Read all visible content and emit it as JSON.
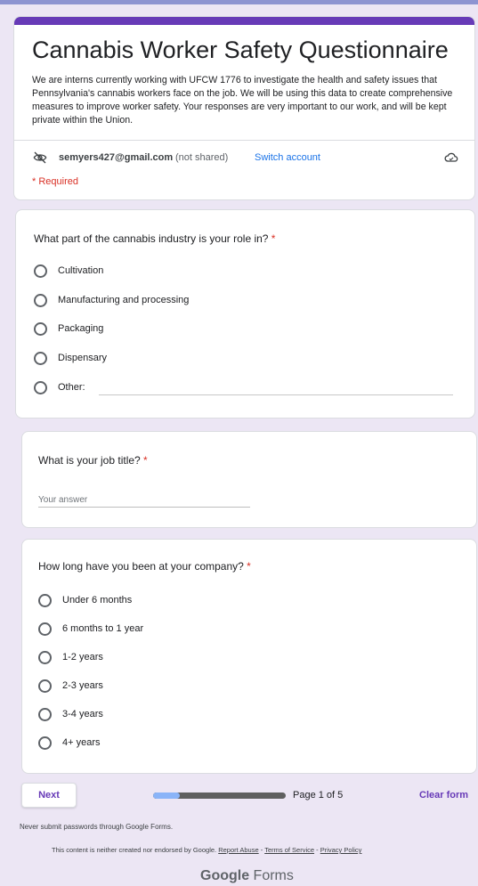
{
  "form": {
    "title": "Cannabis Worker Safety Questionnaire",
    "description": "We are interns currently working with UFCW 1776 to investigate the health and safety issues that Pennsylvania's cannabis workers face on the job. We will be using this data to create comprehensive measures to improve worker safety. Your responses are very important to our work, and will be kept private within the Union.",
    "account_email": "semyers427@gmail.com",
    "not_shared": "(not shared)",
    "switch_account": "Switch account",
    "required_note": "* Required",
    "accent_color": "#673ab7",
    "link_color": "#1a73e8",
    "required_color": "#d93025"
  },
  "q1": {
    "title": "What part of the cannabis industry is your role in?",
    "star": " *",
    "options": [
      "Cultivation",
      "Manufacturing and processing",
      "Packaging",
      "Dispensary",
      "Other:"
    ]
  },
  "q2": {
    "title": "What is your job title?",
    "star": " *",
    "placeholder": "Your answer"
  },
  "q3": {
    "title": "How long have you been at your company?",
    "star": " *",
    "options": [
      "Under 6 months",
      "6 months to 1 year",
      "1-2 years",
      "2-3 years",
      "3-4 years",
      "4+ years"
    ]
  },
  "nav": {
    "next_label": "Next",
    "page_label": "Page 1 of 5",
    "progress_fraction": 0.2,
    "clear_label": "Clear form"
  },
  "footer": {
    "password_warning": "Never submit passwords through Google Forms.",
    "disclaimer": "This content is neither created nor endorsed by Google.",
    "report_abuse": "Report Abuse",
    "terms": "Terms of Service",
    "privacy": "Privacy Policy",
    "separator": " - ",
    "brand_google": "Google",
    "brand_forms": " Forms"
  },
  "icons": {
    "visibility_off": "eye-off-icon",
    "cloud": "cloud-icon",
    "radio": "radio-unchecked-icon"
  }
}
